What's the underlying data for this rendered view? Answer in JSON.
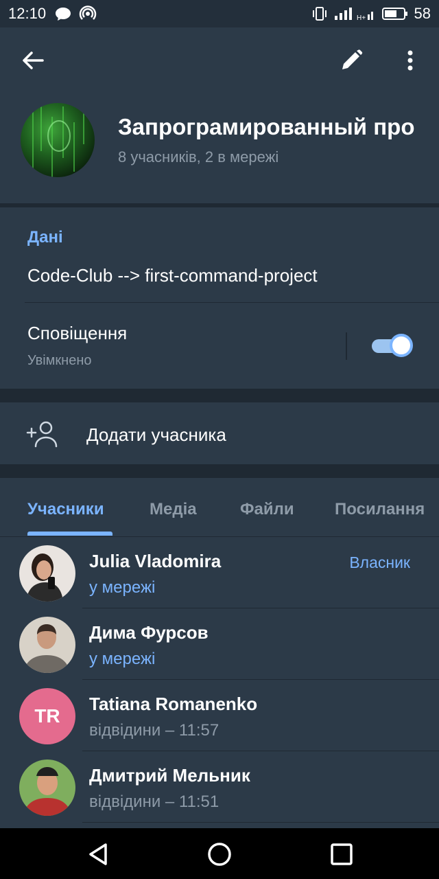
{
  "status_bar": {
    "time": "12:10",
    "battery": "58",
    "icons": [
      "chat-bubble-icon",
      "hotspot-icon",
      "vibrate-icon",
      "signal-icon",
      "battery-icon"
    ]
  },
  "header": {
    "title": "Запрограмированный про",
    "subtitle": "8 учасників, 2 в мережі",
    "icons": [
      "back-arrow-icon",
      "pencil-icon",
      "more-vert-icon"
    ]
  },
  "info": {
    "section_title": "Дані",
    "description": "Code-Club --> first-command-project",
    "notifications_label": "Сповіщення",
    "notifications_status": "Увімкнено",
    "notifications_enabled": true
  },
  "add_member": {
    "label": "Додати учасника",
    "icon": "add-person-icon"
  },
  "tabs": [
    {
      "label": "Учасники",
      "active": true
    },
    {
      "label": "Медіа",
      "active": false
    },
    {
      "label": "Файли",
      "active": false
    },
    {
      "label": "Посилання",
      "active": false
    }
  ],
  "members": [
    {
      "name": "Julia Vladomira",
      "status": "у мережі",
      "role": "Власник"
    },
    {
      "name": "Дима Фурсов",
      "status": "у мережі",
      "role": ""
    },
    {
      "name": "Tatiana Romanenko",
      "status": "відвідини – 11:57",
      "initials": "TR",
      "role": ""
    },
    {
      "name": "Дмитрий Мельник",
      "status": "відвідини – 11:51",
      "role": ""
    }
  ],
  "colors": {
    "accent": "#7bb4ff",
    "panel": "#2c3a48",
    "background": "#1f2933",
    "secondary_text": "#8e9ba8",
    "tr_avatar": "#e46b8e"
  },
  "nav_bar": {
    "icons": [
      "back-triangle-icon",
      "home-circle-icon",
      "recents-square-icon"
    ]
  }
}
